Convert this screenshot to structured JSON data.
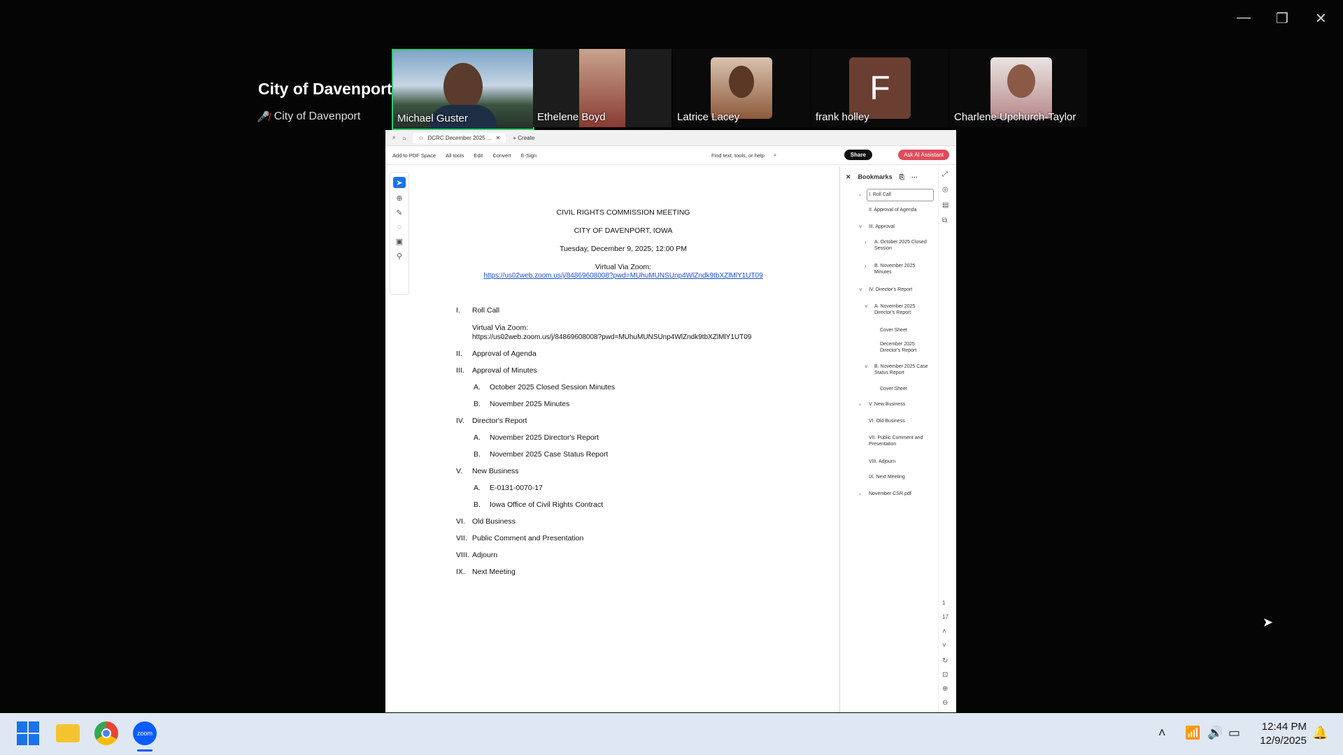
{
  "window_controls": {
    "minimize": "—",
    "restore": "❐",
    "close": "✕"
  },
  "host": {
    "title": "City of Davenport",
    "subtitle": "City of Davenport"
  },
  "participants": [
    {
      "name": "Michael Guster"
    },
    {
      "name": "Ethelene Boyd"
    },
    {
      "name": "Latrice Lacey"
    },
    {
      "name": "frank holley",
      "initial": "F"
    },
    {
      "name": "Charlene Upchurch-Taylor"
    }
  ],
  "shared_screen": {
    "tabs": {
      "active_tab": "DCRC December 2025 ...",
      "new_tab": "+ Create"
    },
    "toolbar": {
      "add_to_pdf": "Add to PDF Space",
      "all_tools": "All tools",
      "edit": "Edit",
      "convert": "Convert",
      "esign": "E-Sign",
      "find": "Find text, tools, or help",
      "share": "Share",
      "ai": "Ask AI Assistant"
    },
    "document": {
      "title": "CIVIL RIGHTS COMMISSION MEETING",
      "city": "CITY OF DAVENPORT, IOWA",
      "date": "Tuesday, December 9, 2025; 12:00 PM",
      "virtual": "Virtual Via Zoom:",
      "link": "https://us02web.zoom.us/j/84869608008?pwd=MUhuMUNSUnp4WlZndk9tbXZlMlY1UT09",
      "agenda": [
        {
          "num": "I.",
          "text": "Roll Call"
        },
        {
          "num": "",
          "text": "Virtual Via Zoom:"
        },
        {
          "num": "",
          "text": "https://us02web.zoom.us/j/84869608008?pwd=MUhuMUNSUnp4WlZndk9tbXZlMlY1UT09"
        },
        {
          "num": "II.",
          "text": "Approval of Agenda"
        },
        {
          "num": "III.",
          "text": "Approval of Minutes"
        },
        {
          "num": "A.",
          "text": "October 2025 Closed Session Minutes"
        },
        {
          "num": "B.",
          "text": "November 2025 Minutes"
        },
        {
          "num": "IV.",
          "text": "Director's Report"
        },
        {
          "num": "A.",
          "text": "November 2025 Director's Report"
        },
        {
          "num": "B.",
          "text": "November 2025 Case Status Report"
        },
        {
          "num": "V.",
          "text": "New Business"
        },
        {
          "num": "A.",
          "text": "E-0131-0070-17"
        },
        {
          "num": "B.",
          "text": "Iowa Office of Civil Rights Contract"
        },
        {
          "num": "VI.",
          "text": "Old Business"
        },
        {
          "num": "VII.",
          "text": "Public Comment and Presentation"
        },
        {
          "num": "VIII.",
          "text": "Adjourn"
        },
        {
          "num": "IX.",
          "text": "Next Meeting"
        }
      ]
    },
    "bookmarks": {
      "heading": "Bookmarks",
      "items": [
        "I. Roll Call",
        "II. Approval of Agenda",
        "III. Approval",
        "A. October 2025 Closed Session",
        "B. November 2025 Minutes",
        "IV. Director's Report",
        "A. November 2025 Director's Report",
        "Cover Sheet",
        "December 2025 Director's Report",
        "B. November 2025 Case Status Report",
        "Cover Sheet",
        "V. New Business",
        "VI. Old Business",
        "VII. Public Comment and Presentation",
        "VIII. Adjourn",
        "IX. Next Meeting",
        "November CSR.pdf"
      ]
    },
    "page_indicator": {
      "current": "1",
      "total": "17"
    }
  },
  "taskbar": {
    "time": "12:44 PM",
    "date": "12/9/2025",
    "zoom_label": "zoom"
  }
}
